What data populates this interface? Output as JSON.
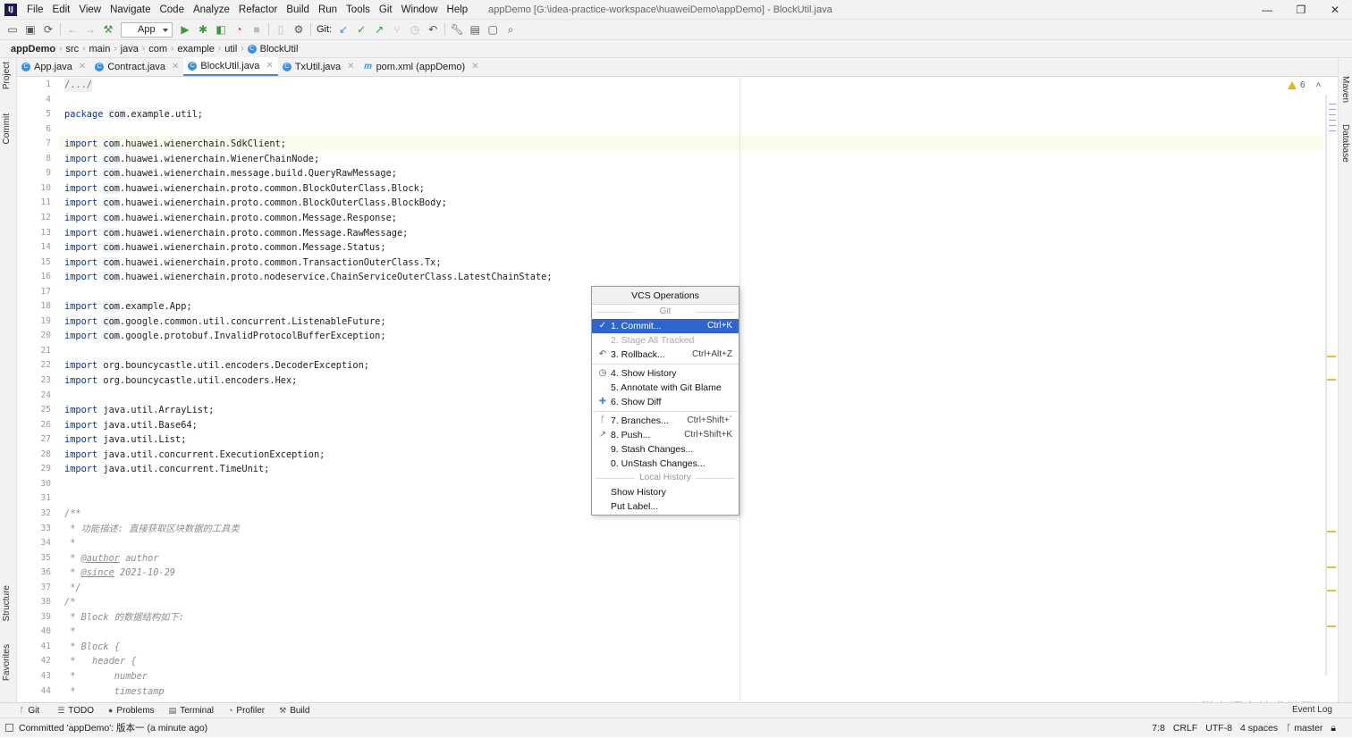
{
  "menubar": {
    "items": [
      "File",
      "Edit",
      "View",
      "Navigate",
      "Code",
      "Analyze",
      "Refactor",
      "Build",
      "Run",
      "Tools",
      "Git",
      "Window",
      "Help"
    ],
    "title": "appDemo [G:\\idea-practice-workspace\\huaweiDemo\\appDemo] - BlockUtil.java"
  },
  "toolbar": {
    "run_config": "App",
    "git_label": "Git:"
  },
  "breadcrumb": [
    "appDemo",
    "src",
    "main",
    "java",
    "com",
    "example",
    "util",
    "BlockUtil"
  ],
  "left_tabs": [
    "Project",
    "Commit",
    "Structure",
    "Favorites"
  ],
  "right_tabs": [
    "Maven",
    "Database"
  ],
  "tabs": [
    {
      "label": "App.java",
      "icon": "C"
    },
    {
      "label": "Contract.java",
      "icon": "C"
    },
    {
      "label": "BlockUtil.java",
      "icon": "C",
      "active": true
    },
    {
      "label": "TxUtil.java",
      "icon": "C"
    },
    {
      "label": "pom.xml (appDemo)",
      "icon": "m"
    }
  ],
  "warnings": "6",
  "lines": [
    {
      "n": "1",
      "text": "/.../"
    },
    {
      "n": "4",
      "text": ""
    },
    {
      "n": "5",
      "text": "package com.example.util;"
    },
    {
      "n": "6",
      "text": ""
    },
    {
      "n": "7",
      "text": "import com.huawei.wienerchain.SdkClient;"
    },
    {
      "n": "8",
      "text": "import com.huawei.wienerchain.WienerChainNode;"
    },
    {
      "n": "9",
      "text": "import com.huawei.wienerchain.message.build.QueryRawMessage;"
    },
    {
      "n": "10",
      "text": "import com.huawei.wienerchain.proto.common.BlockOuterClass.Block;"
    },
    {
      "n": "11",
      "text": "import com.huawei.wienerchain.proto.common.BlockOuterClass.BlockBody;"
    },
    {
      "n": "12",
      "text": "import com.huawei.wienerchain.proto.common.Message.Response;"
    },
    {
      "n": "13",
      "text": "import com.huawei.wienerchain.proto.common.Message.RawMessage;"
    },
    {
      "n": "14",
      "text": "import com.huawei.wienerchain.proto.common.Message.Status;"
    },
    {
      "n": "15",
      "text": "import com.huawei.wienerchain.proto.common.TransactionOuterClass.Tx;"
    },
    {
      "n": "16",
      "text": "import com.huawei.wienerchain.proto.nodeservice.ChainServiceOuterClass.LatestChainState;"
    },
    {
      "n": "17",
      "text": ""
    },
    {
      "n": "18",
      "text": "import com.example.App;"
    },
    {
      "n": "19",
      "text": "import com.google.common.util.concurrent.ListenableFuture;"
    },
    {
      "n": "20",
      "text": "import com.google.protobuf.InvalidProtocolBufferException;"
    },
    {
      "n": "21",
      "text": ""
    },
    {
      "n": "22",
      "text": "import org.bouncycastle.util.encoders.DecoderException;"
    },
    {
      "n": "23",
      "text": "import org.bouncycastle.util.encoders.Hex;"
    },
    {
      "n": "24",
      "text": ""
    },
    {
      "n": "25",
      "text": "import java.util.ArrayList;"
    },
    {
      "n": "26",
      "text": "import java.util.Base64;"
    },
    {
      "n": "27",
      "text": "import java.util.List;"
    },
    {
      "n": "28",
      "text": "import java.util.concurrent.ExecutionException;"
    },
    {
      "n": "29",
      "text": "import java.util.concurrent.TimeUnit;"
    },
    {
      "n": "30",
      "text": ""
    },
    {
      "n": "31",
      "text": ""
    },
    {
      "n": "32",
      "text": "/**"
    },
    {
      "n": "33",
      "text": " * 功能描述: 直接获取区块数据的工具类"
    },
    {
      "n": "34",
      "text": " *"
    },
    {
      "n": "35",
      "text": " * @author author"
    },
    {
      "n": "36",
      "text": " * @since 2021-10-29"
    },
    {
      "n": "37",
      "text": " */"
    },
    {
      "n": "38",
      "text": "/*"
    },
    {
      "n": "39",
      "text": " * Block 的数据结构如下:"
    },
    {
      "n": "40",
      "text": " *"
    },
    {
      "n": "41",
      "text": " * Block {"
    },
    {
      "n": "42",
      "text": " *   header {"
    },
    {
      "n": "43",
      "text": " *       number"
    },
    {
      "n": "44",
      "text": " *       timestamp"
    }
  ],
  "popup": {
    "title": "VCS Operations",
    "group_git": "Git",
    "group_local": "Local History",
    "items": [
      {
        "label": "1. Commit...",
        "shortcut": "Ctrl+K",
        "icon": "✓"
      },
      {
        "label": "2. Stage All Tracked",
        "shortcut": "",
        "icon": ""
      },
      {
        "label": "3. Rollback...",
        "shortcut": "Ctrl+Alt+Z",
        "icon": "↶"
      },
      {
        "label": "4. Show History",
        "shortcut": "",
        "icon": "◷"
      },
      {
        "label": "5. Annotate with Git Blame",
        "shortcut": "",
        "icon": ""
      },
      {
        "label": "6. Show Diff",
        "shortcut": "",
        "icon": "✚"
      },
      {
        "label": "7. Branches...",
        "shortcut": "Ctrl+Shift+`",
        "icon": "ᚴ"
      },
      {
        "label": "8. Push...",
        "shortcut": "Ctrl+Shift+K",
        "icon": "↗"
      },
      {
        "label": "9. Stash Changes...",
        "shortcut": "",
        "icon": ""
      },
      {
        "label": "0. UnStash Changes...",
        "shortcut": "",
        "icon": ""
      },
      {
        "label": "Show History",
        "shortcut": "",
        "icon": ""
      },
      {
        "label": "Put Label...",
        "shortcut": "",
        "icon": ""
      }
    ]
  },
  "bottom_tabs": [
    "Git",
    "TODO",
    "Problems",
    "Terminal",
    "Profiler",
    "Build"
  ],
  "event_log": "Event Log",
  "status": {
    "message": "Committed 'appDemo': 版本一 (a minute ago)",
    "position": "7:8",
    "line_sep": "CRLF",
    "encoding": "UTF-8",
    "indent": "4 spaces",
    "branch": "master"
  },
  "watermark": "@稀土掘金技术社区"
}
